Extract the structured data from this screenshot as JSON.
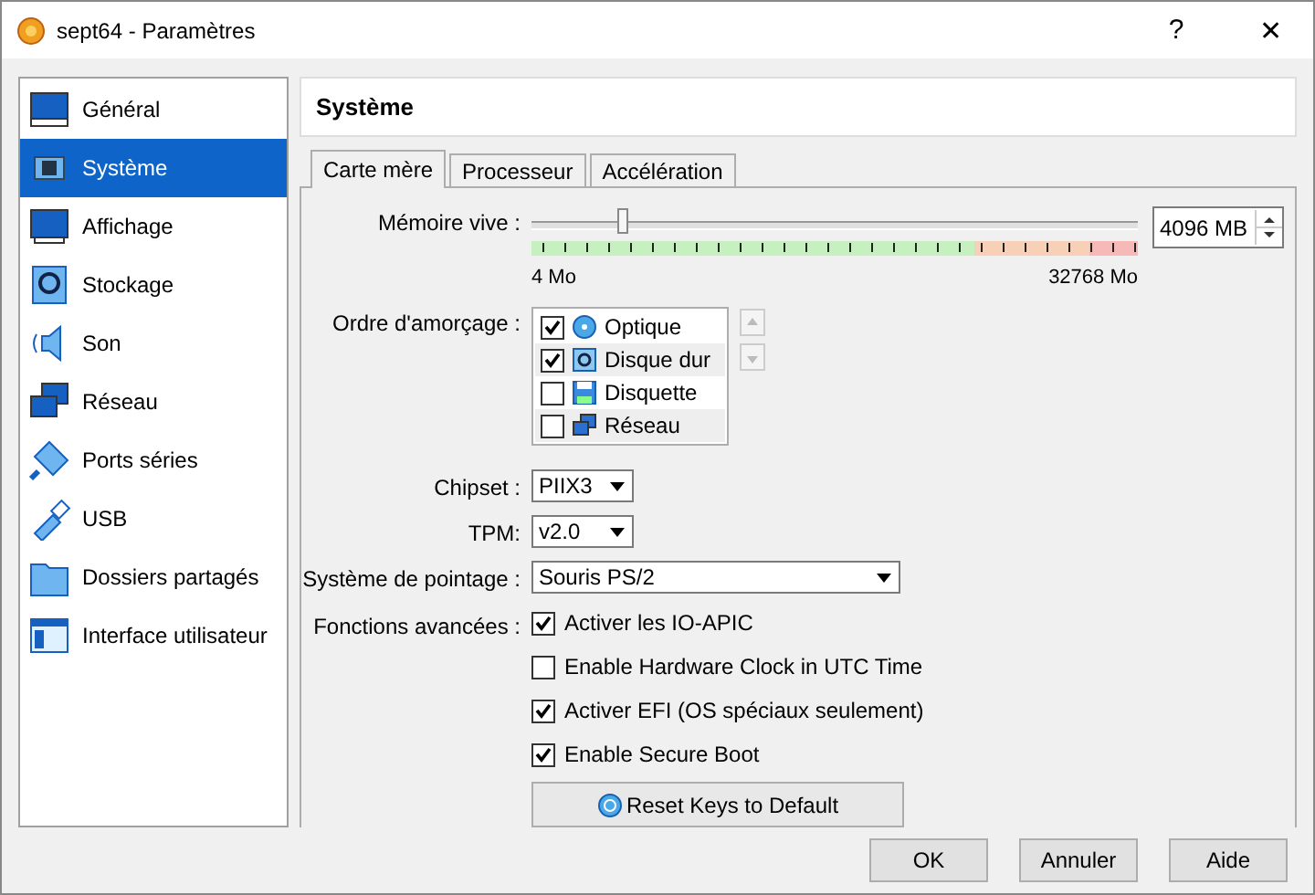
{
  "window": {
    "title": "sept64 - Paramètres",
    "help": "?",
    "close": "✕"
  },
  "sidebar": {
    "items": [
      {
        "label": "Général",
        "selected": false
      },
      {
        "label": "Système",
        "selected": true
      },
      {
        "label": "Affichage",
        "selected": false
      },
      {
        "label": "Stockage",
        "selected": false
      },
      {
        "label": "Son",
        "selected": false
      },
      {
        "label": "Réseau",
        "selected": false
      },
      {
        "label": "Ports séries",
        "selected": false
      },
      {
        "label": "USB",
        "selected": false
      },
      {
        "label": "Dossiers partagés",
        "selected": false
      },
      {
        "label": "Interface utilisateur",
        "selected": false
      }
    ]
  },
  "page_title": "Système",
  "tabs": [
    {
      "label": "Carte mère",
      "selected": true
    },
    {
      "label": "Processeur",
      "selected": false
    },
    {
      "label": "Accélération",
      "selected": false
    }
  ],
  "memory": {
    "label": "Mémoire vive :",
    "level": 0.15,
    "min": "4 Mo",
    "max": "32768 Mo",
    "value": "4096 MB"
  },
  "boot_order": {
    "label": "Ordre d'amorçage :",
    "items": [
      {
        "label": "Optique",
        "checked": true
      },
      {
        "label": "Disque dur",
        "checked": true
      },
      {
        "label": "Disquette",
        "checked": false
      },
      {
        "label": "Réseau",
        "checked": false
      }
    ]
  },
  "chipset": {
    "label": "Chipset :",
    "value": "PIIX3"
  },
  "tpm": {
    "label": "TPM:",
    "value": "v2.0"
  },
  "pointing": {
    "label": "Système de pointage :",
    "value": "Souris PS/2"
  },
  "features": {
    "label": "Fonctions avancées :",
    "items": [
      {
        "label": "Activer les IO-APIC",
        "checked": true
      },
      {
        "label": "Enable Hardware Clock in UTC Time",
        "checked": false
      },
      {
        "label": "Activer EFI (OS spéciaux seulement)",
        "checked": true
      },
      {
        "label": "Enable Secure Boot",
        "checked": true
      }
    ]
  },
  "reset_button": "Reset Keys to Default",
  "buttons": [
    "OK",
    "Annuler",
    "Aide"
  ]
}
